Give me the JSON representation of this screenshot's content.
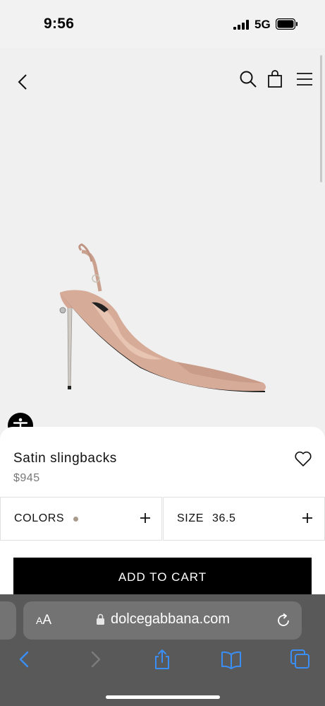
{
  "status_bar": {
    "time": "9:56",
    "network": "5G"
  },
  "header": {
    "icons": [
      "chevron-left-icon",
      "search-icon",
      "shopping-bag-icon",
      "hamburger-menu-icon"
    ]
  },
  "product": {
    "name": "Satin slingbacks",
    "price": "$945",
    "colors_label": "COLORS",
    "selected_color": "#a89b8b",
    "size_label": "SIZE",
    "size_value": "36.5",
    "add_to_cart_label": "ADD TO CART"
  },
  "browser": {
    "text_size_label": "A",
    "text_size_label_small": "A",
    "url": "dolcegabbana.com"
  },
  "colors": {
    "background": "#f2f2f2",
    "button": "#000000",
    "safari_toolbar": "#595959",
    "safari_accent": "#3a8ef5"
  }
}
